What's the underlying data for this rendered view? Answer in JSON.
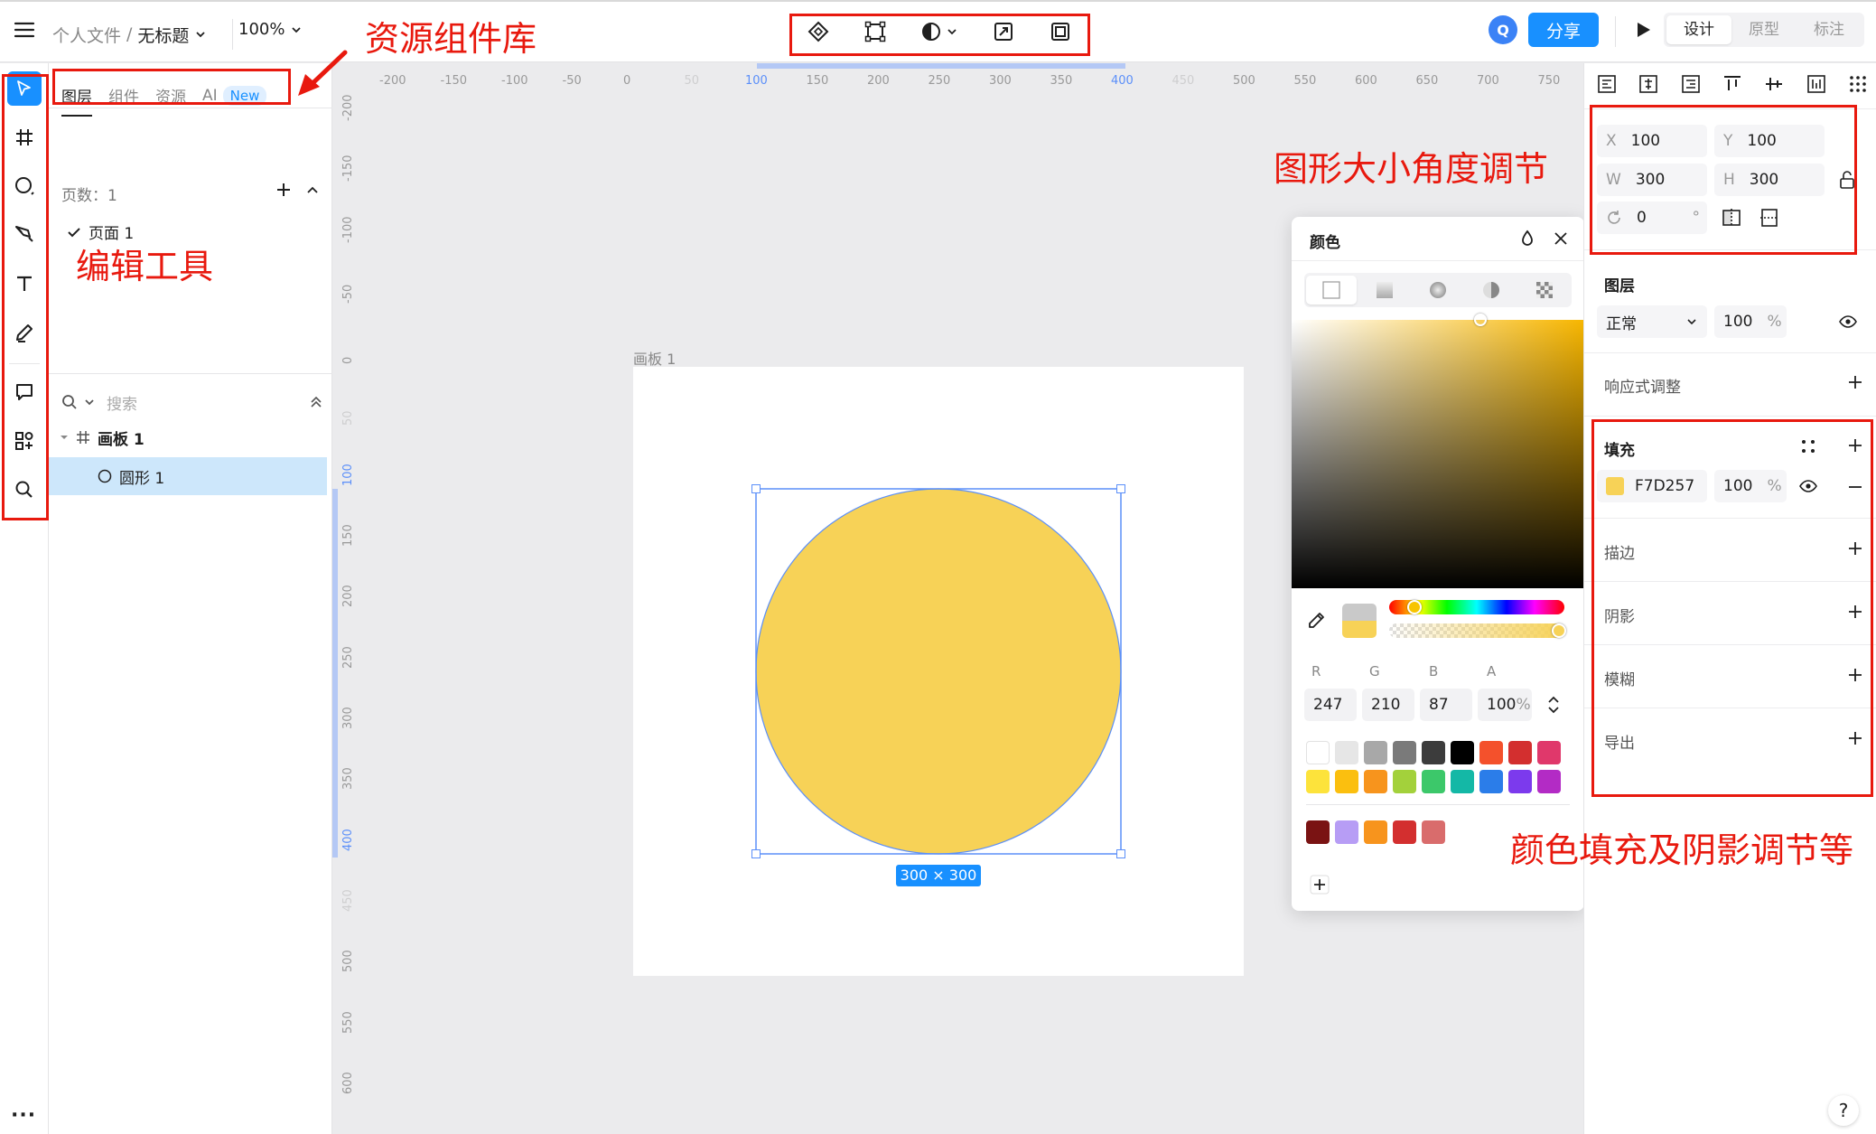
{
  "topbar": {
    "breadcrumb_root": "个人文件",
    "breadcrumb_sep": "/",
    "file_name": "无标题",
    "zoom": "100%",
    "avatar_letter": "Q",
    "share_label": "分享",
    "mode_tabs": [
      "设计",
      "原型",
      "标注"
    ]
  },
  "layer_panel": {
    "tabs": [
      "图层",
      "组件",
      "资源",
      "AI"
    ],
    "new_badge": "New",
    "page_count": "页数：1",
    "page_name": "页面 1",
    "search_placeholder": "搜索",
    "artboard_name": "画板 1",
    "shape_name": "圆形 1"
  },
  "canvas": {
    "artboard_label": "画板 1",
    "size_badge": "300 × 300",
    "fill_color": "#F7D257",
    "accent_color": "#1890ff",
    "hruler_ticks": [
      "-200",
      "-150",
      "-100",
      "-50",
      "0",
      "50",
      "100",
      "150",
      "200",
      "250",
      "300",
      "350",
      "400",
      "450",
      "500",
      "550",
      "600",
      "650",
      "700",
      "750"
    ],
    "vruler_ticks": [
      "-200",
      "-150",
      "-100",
      "-50",
      "0",
      "50",
      "100",
      "150",
      "200",
      "250",
      "300",
      "350",
      "400",
      "450",
      "500",
      "550",
      "600"
    ]
  },
  "color_picker": {
    "title": "颜色",
    "r_label": "R",
    "g_label": "G",
    "b_label": "B",
    "a_label": "A",
    "r": "247",
    "g": "210",
    "b": "87",
    "a": "100",
    "percent": "%",
    "swatches": [
      "#ffffff",
      "#e6e6e6",
      "#a8a8a8",
      "#7a7a7a",
      "#3c3c3c",
      "#000000",
      "#f4512c",
      "#d32f2f",
      "#e0386b",
      "#fde33b",
      "#fbbf0f",
      "#f7941d",
      "#a3d13b",
      "#3cc86a",
      "#14b8a6",
      "#2b7de9",
      "#7c3aed",
      "#b32bc5"
    ],
    "recent_swatches": [
      "#7a1313",
      "#b79df5",
      "#f7941d",
      "#d32f2f",
      "#d96c6c"
    ]
  },
  "right_panel": {
    "x_label": "X",
    "x": "100",
    "y_label": "Y",
    "y": "100",
    "w_label": "W",
    "w": "300",
    "h_label": "H",
    "h": "300",
    "rotation": "0",
    "degree": "°",
    "layer_title": "图层",
    "blend_mode": "正常",
    "opacity": "100",
    "percent": "%",
    "responsive": "响应式调整",
    "fill_title": "填充",
    "fill_hex": "F7D257",
    "fill_opacity": "100",
    "stroke": "描边",
    "shadow": "阴影",
    "blur": "模糊",
    "export": "导出"
  },
  "annotations": {
    "assets": "资源组件库",
    "edit_tools": "编辑工具",
    "size_angle": "图形大小角度调节",
    "fill_shadow": "颜色填充及阴影调节等"
  }
}
